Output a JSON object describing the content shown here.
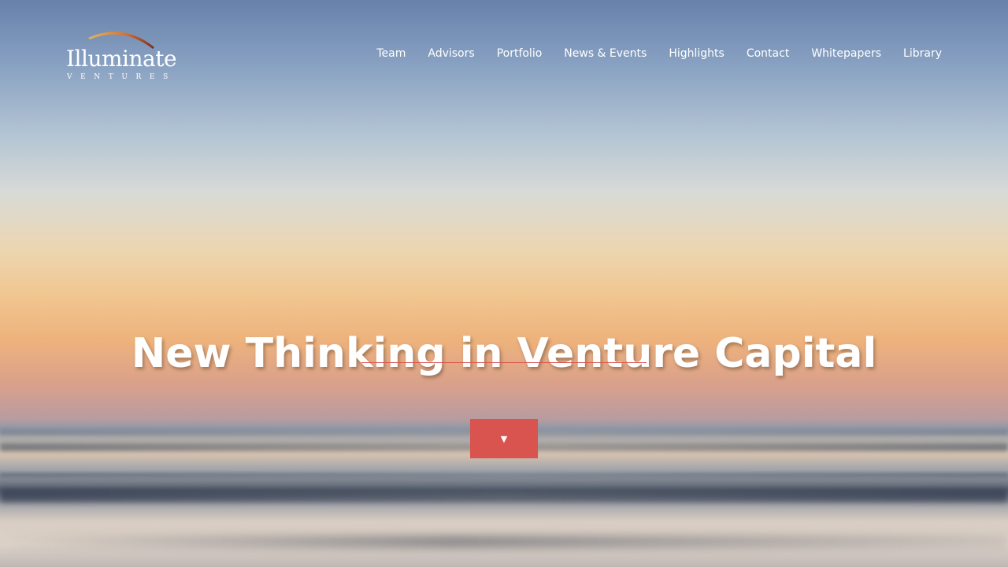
{
  "logo": {
    "name": "Illuminate",
    "subtitle": "VENTURES",
    "arc_colors": [
      "#f0a040",
      "#c55b2a",
      "#8a3a2a"
    ]
  },
  "nav": {
    "items": [
      {
        "label": "Team"
      },
      {
        "label": "Advisors"
      },
      {
        "label": "Portfolio"
      },
      {
        "label": "News & Events"
      },
      {
        "label": "Highlights"
      },
      {
        "label": "Contact"
      },
      {
        "label": "Whitepapers"
      },
      {
        "label": "Library"
      }
    ]
  },
  "hero": {
    "headline": "New Thinking in Venture Capital",
    "scroll_icon": "triangle-down-icon",
    "scroll_glyph": "▼"
  },
  "colors": {
    "accent": "#d9534f",
    "text": "#ffffff"
  }
}
